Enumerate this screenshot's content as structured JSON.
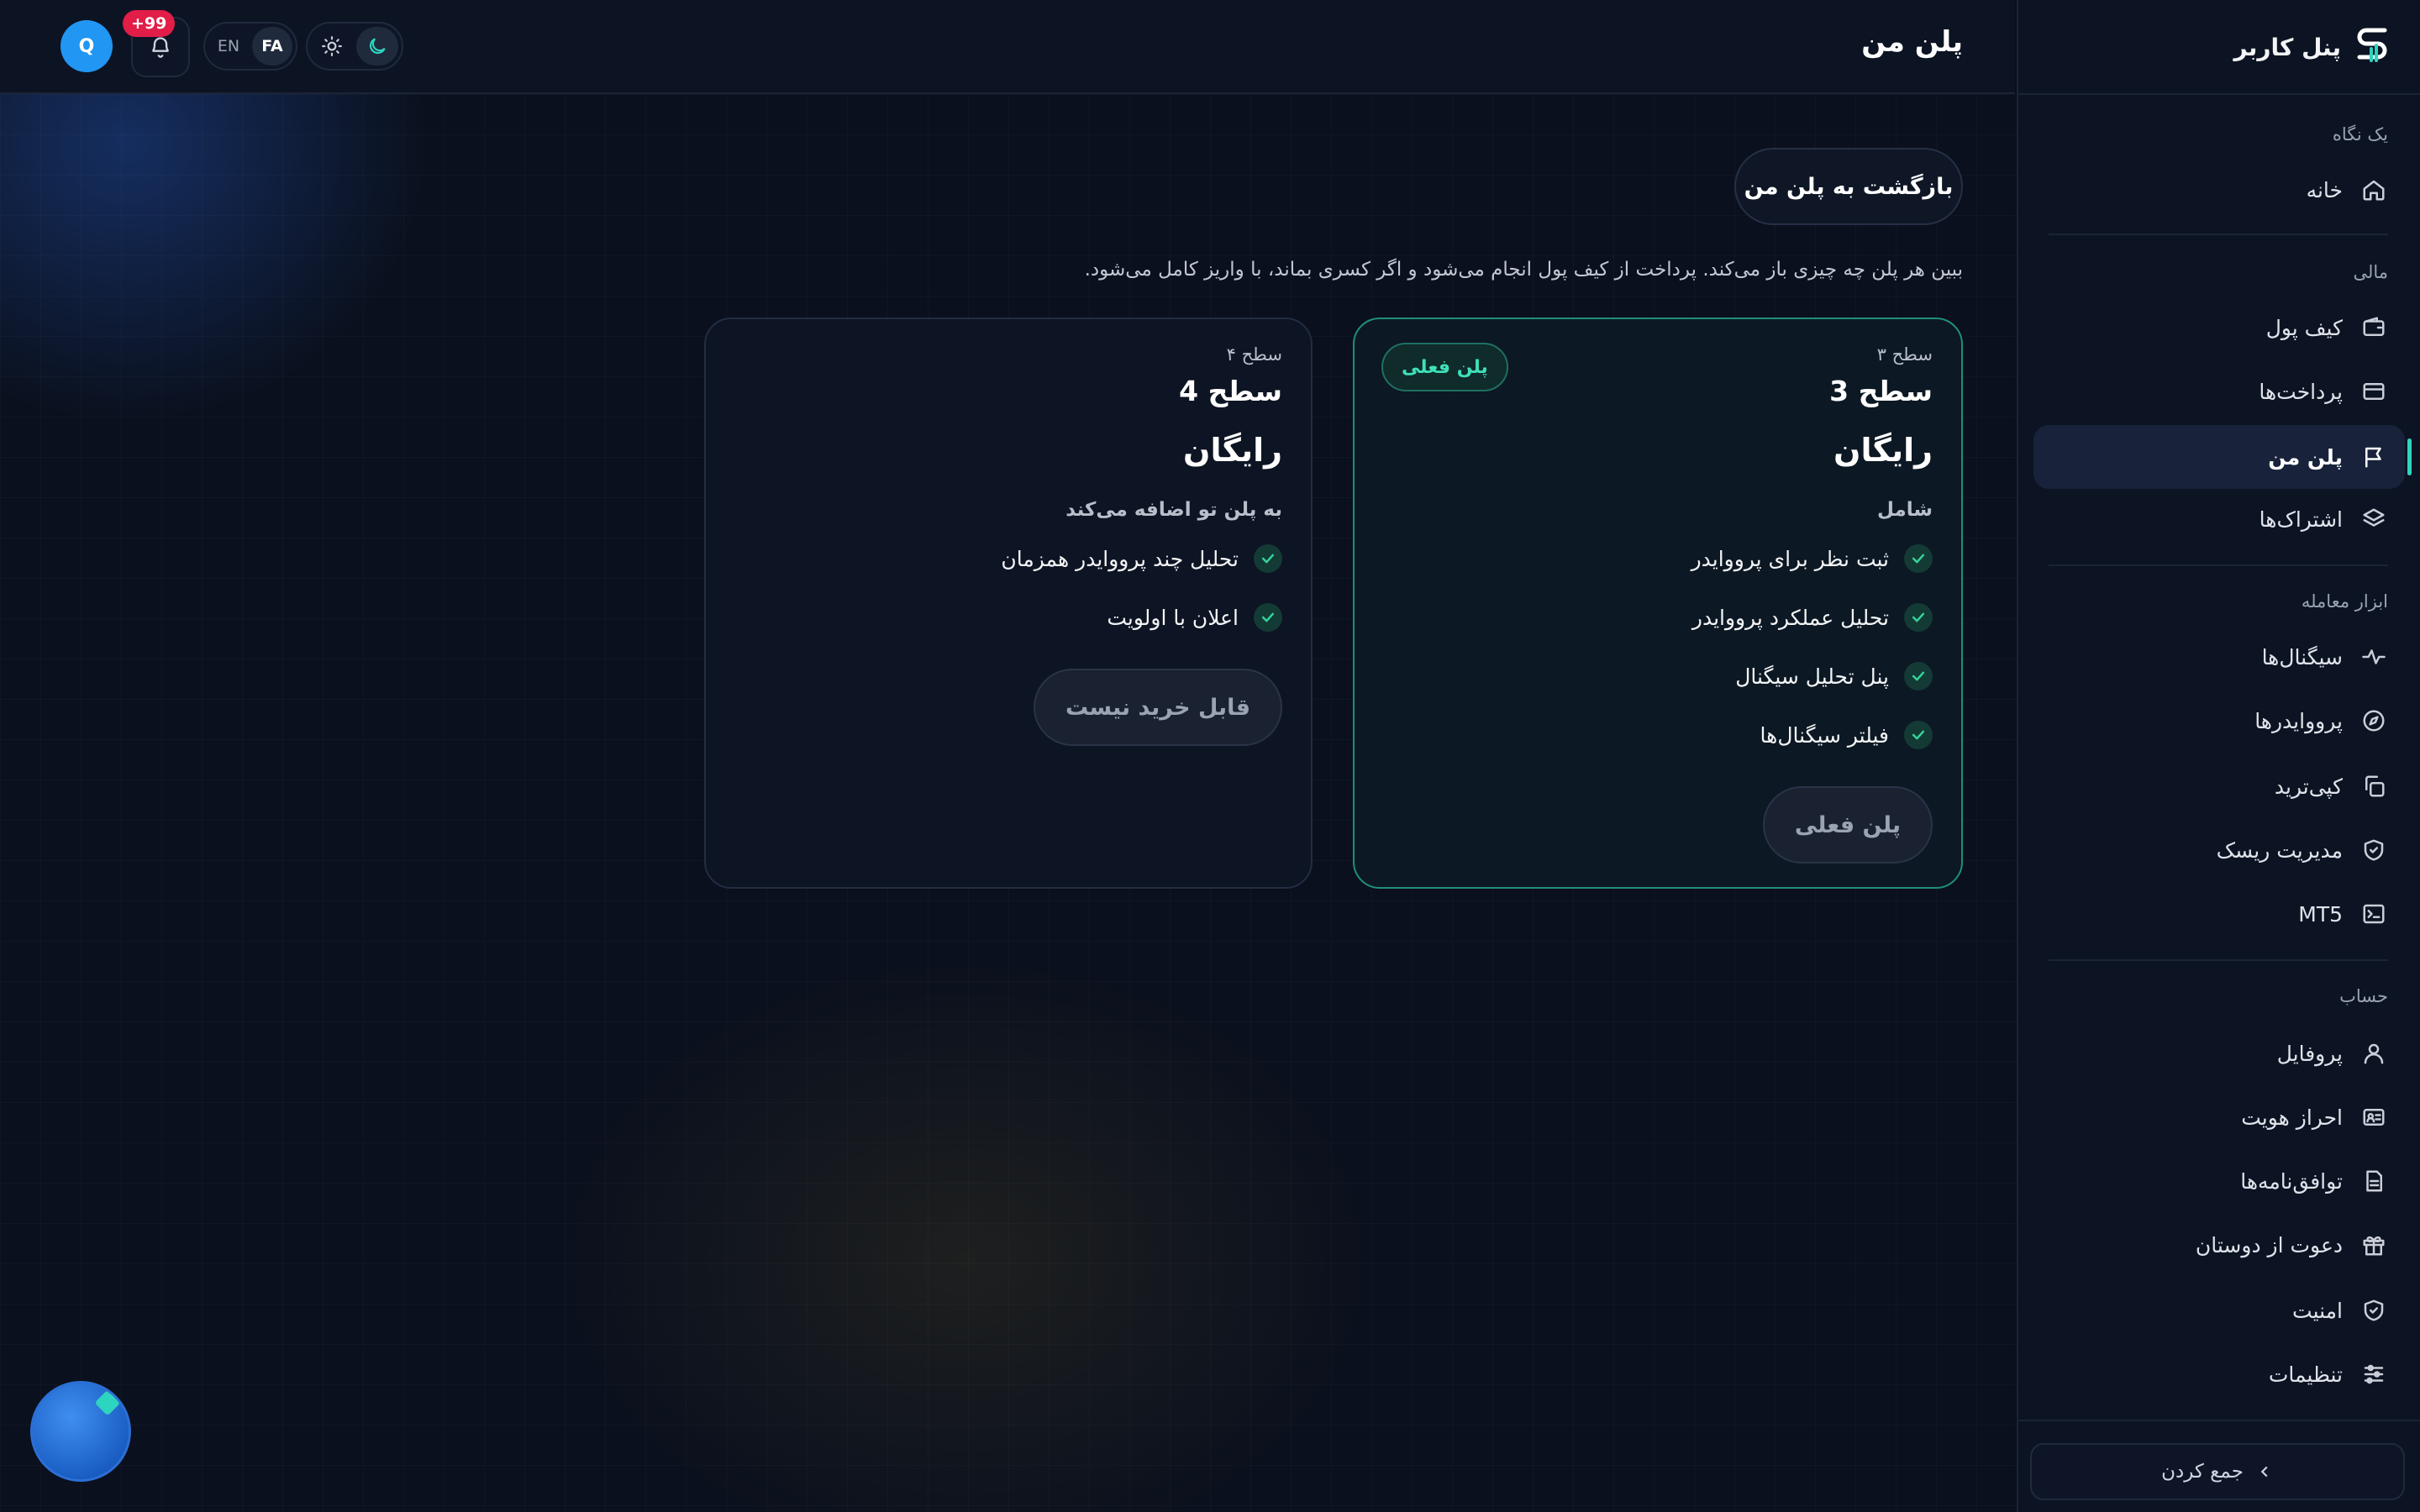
{
  "header": {
    "title": "پلن من",
    "avatar_initial": "Q",
    "notification_badge": "+99",
    "languages": [
      "FA",
      "EN"
    ],
    "active_language": "FA",
    "theme_icons": [
      "moon-icon",
      "sun-icon"
    ]
  },
  "sidebar": {
    "brand": "پنل کاربر",
    "sections": {
      "glance": "یک نگاه",
      "finance": "مالی",
      "trading_tools": "ابزار معامله",
      "account": "حساب"
    },
    "items": {
      "home": "خانه",
      "wallet": "کیف پول",
      "payments": "پرداخت‌ها",
      "my_plan": "پلن من",
      "subscriptions": "اشتراک‌ها",
      "signals": "سیگنال‌ها",
      "providers": "پرووایدرها",
      "copytrade": "کپی‌ترید",
      "risk": "مدیریت ریسک",
      "mt5": "MT5",
      "profile": "پروفایل",
      "kyc": "احراز هویت",
      "agreements": "توافق‌نامه‌ها",
      "invite": "دعوت از دوستان",
      "security": "امنیت",
      "settings": "تنظیمات"
    },
    "collapse_label": "جمع کردن"
  },
  "main": {
    "back_button": "بازگشت به پلن من",
    "description": "ببین هر پلن چه چیزی باز می‌کند. پرداخت از کیف پول انجام می‌شود و اگر کسری بماند، با واریز کامل می‌شود.",
    "plans": [
      {
        "level_small": "سطح ۳",
        "level": "سطح 3",
        "price": "رایگان",
        "section_label": "شامل",
        "badge": "پلن فعلی",
        "features": [
          "ثبت نظر برای پرووایدر",
          "تحلیل عملکرد پرووایدر",
          "پنل تحلیل سیگنال",
          "فیلتر سیگنال‌ها"
        ],
        "button": "پلن فعلی"
      },
      {
        "level_small": "سطح ۴",
        "level": "سطح 4",
        "price": "رایگان",
        "section_label": "به پلن تو اضافه می‌کند",
        "features": [
          "تحلیل چند پرووایدر همزمان",
          "اعلان با اولویت"
        ],
        "button": "قابل خرید نیست"
      }
    ]
  },
  "colors": {
    "accent": "#2dd4bf",
    "badge": "#e11d48",
    "avatar": "#2196f3",
    "current_plan_border": "#1f8f7c"
  }
}
